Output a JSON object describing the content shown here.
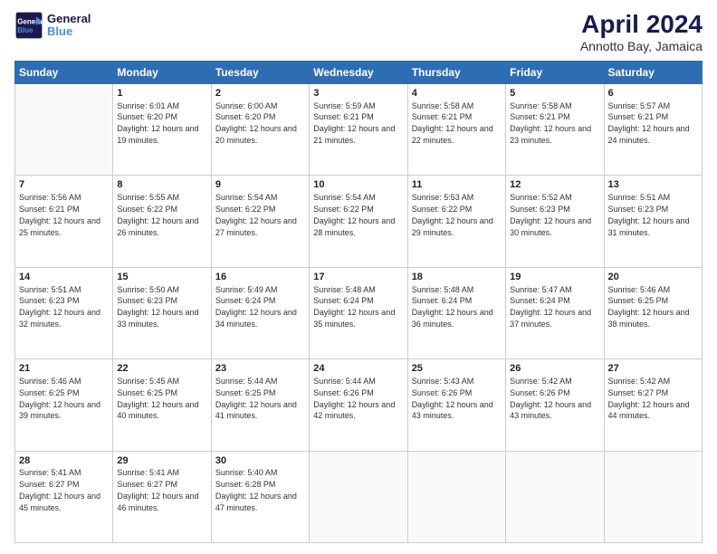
{
  "logo": {
    "line1": "General",
    "line2": "Blue"
  },
  "title": "April 2024",
  "subtitle": "Annotto Bay, Jamaica",
  "days_of_week": [
    "Sunday",
    "Monday",
    "Tuesday",
    "Wednesday",
    "Thursday",
    "Friday",
    "Saturday"
  ],
  "weeks": [
    [
      {
        "day": "",
        "sunrise": "",
        "sunset": "",
        "daylight": ""
      },
      {
        "day": "1",
        "sunrise": "6:01 AM",
        "sunset": "6:20 PM",
        "daylight": "12 hours and 19 minutes."
      },
      {
        "day": "2",
        "sunrise": "6:00 AM",
        "sunset": "6:20 PM",
        "daylight": "12 hours and 20 minutes."
      },
      {
        "day": "3",
        "sunrise": "5:59 AM",
        "sunset": "6:21 PM",
        "daylight": "12 hours and 21 minutes."
      },
      {
        "day": "4",
        "sunrise": "5:58 AM",
        "sunset": "6:21 PM",
        "daylight": "12 hours and 22 minutes."
      },
      {
        "day": "5",
        "sunrise": "5:58 AM",
        "sunset": "6:21 PM",
        "daylight": "12 hours and 23 minutes."
      },
      {
        "day": "6",
        "sunrise": "5:57 AM",
        "sunset": "6:21 PM",
        "daylight": "12 hours and 24 minutes."
      }
    ],
    [
      {
        "day": "7",
        "sunrise": "5:56 AM",
        "sunset": "6:21 PM",
        "daylight": "12 hours and 25 minutes."
      },
      {
        "day": "8",
        "sunrise": "5:55 AM",
        "sunset": "6:22 PM",
        "daylight": "12 hours and 26 minutes."
      },
      {
        "day": "9",
        "sunrise": "5:54 AM",
        "sunset": "6:22 PM",
        "daylight": "12 hours and 27 minutes."
      },
      {
        "day": "10",
        "sunrise": "5:54 AM",
        "sunset": "6:22 PM",
        "daylight": "12 hours and 28 minutes."
      },
      {
        "day": "11",
        "sunrise": "5:53 AM",
        "sunset": "6:22 PM",
        "daylight": "12 hours and 29 minutes."
      },
      {
        "day": "12",
        "sunrise": "5:52 AM",
        "sunset": "6:23 PM",
        "daylight": "12 hours and 30 minutes."
      },
      {
        "day": "13",
        "sunrise": "5:51 AM",
        "sunset": "6:23 PM",
        "daylight": "12 hours and 31 minutes."
      }
    ],
    [
      {
        "day": "14",
        "sunrise": "5:51 AM",
        "sunset": "6:23 PM",
        "daylight": "12 hours and 32 minutes."
      },
      {
        "day": "15",
        "sunrise": "5:50 AM",
        "sunset": "6:23 PM",
        "daylight": "12 hours and 33 minutes."
      },
      {
        "day": "16",
        "sunrise": "5:49 AM",
        "sunset": "6:24 PM",
        "daylight": "12 hours and 34 minutes."
      },
      {
        "day": "17",
        "sunrise": "5:48 AM",
        "sunset": "6:24 PM",
        "daylight": "12 hours and 35 minutes."
      },
      {
        "day": "18",
        "sunrise": "5:48 AM",
        "sunset": "6:24 PM",
        "daylight": "12 hours and 36 minutes."
      },
      {
        "day": "19",
        "sunrise": "5:47 AM",
        "sunset": "6:24 PM",
        "daylight": "12 hours and 37 minutes."
      },
      {
        "day": "20",
        "sunrise": "5:46 AM",
        "sunset": "6:25 PM",
        "daylight": "12 hours and 38 minutes."
      }
    ],
    [
      {
        "day": "21",
        "sunrise": "5:46 AM",
        "sunset": "6:25 PM",
        "daylight": "12 hours and 39 minutes."
      },
      {
        "day": "22",
        "sunrise": "5:45 AM",
        "sunset": "6:25 PM",
        "daylight": "12 hours and 40 minutes."
      },
      {
        "day": "23",
        "sunrise": "5:44 AM",
        "sunset": "6:25 PM",
        "daylight": "12 hours and 41 minutes."
      },
      {
        "day": "24",
        "sunrise": "5:44 AM",
        "sunset": "6:26 PM",
        "daylight": "12 hours and 42 minutes."
      },
      {
        "day": "25",
        "sunrise": "5:43 AM",
        "sunset": "6:26 PM",
        "daylight": "12 hours and 43 minutes."
      },
      {
        "day": "26",
        "sunrise": "5:42 AM",
        "sunset": "6:26 PM",
        "daylight": "12 hours and 43 minutes."
      },
      {
        "day": "27",
        "sunrise": "5:42 AM",
        "sunset": "6:27 PM",
        "daylight": "12 hours and 44 minutes."
      }
    ],
    [
      {
        "day": "28",
        "sunrise": "5:41 AM",
        "sunset": "6:27 PM",
        "daylight": "12 hours and 45 minutes."
      },
      {
        "day": "29",
        "sunrise": "5:41 AM",
        "sunset": "6:27 PM",
        "daylight": "12 hours and 46 minutes."
      },
      {
        "day": "30",
        "sunrise": "5:40 AM",
        "sunset": "6:28 PM",
        "daylight": "12 hours and 47 minutes."
      },
      {
        "day": "",
        "sunrise": "",
        "sunset": "",
        "daylight": ""
      },
      {
        "day": "",
        "sunrise": "",
        "sunset": "",
        "daylight": ""
      },
      {
        "day": "",
        "sunrise": "",
        "sunset": "",
        "daylight": ""
      },
      {
        "day": "",
        "sunrise": "",
        "sunset": "",
        "daylight": ""
      }
    ]
  ]
}
